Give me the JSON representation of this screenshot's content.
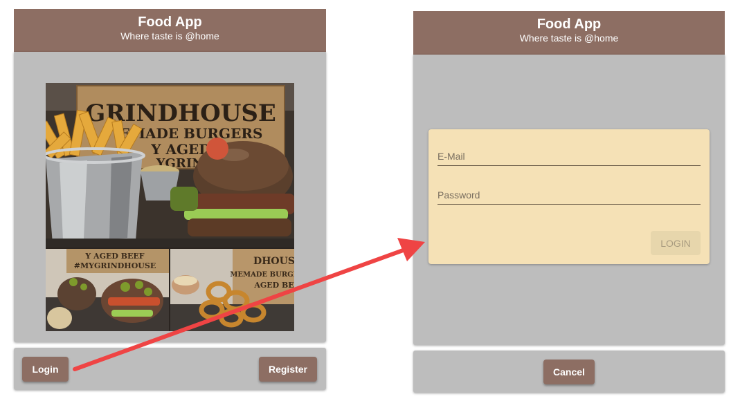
{
  "left_screen": {
    "header": {
      "title": "Food App",
      "subtitle": "Where taste is @home"
    },
    "collage": {
      "main_photo": {
        "sign_line1": "GRINDHOUSE",
        "sign_line2": "EMADE BURGERS",
        "sign_line3": "Y AGED BE",
        "sign_line4": "YGRINDH"
      },
      "bottom_left_photo": {
        "sign_text1": "Y AGED BEEF",
        "sign_text2": "#MYGRINDHOUSE"
      },
      "bottom_right_photo": {
        "sign_text1": "DHOUS",
        "sign_text2": "MEMADE BURGER",
        "sign_text3": "AGED BE"
      }
    },
    "footer": {
      "login_label": "Login",
      "register_label": "Register"
    }
  },
  "right_screen": {
    "header": {
      "title": "Food App",
      "subtitle": "Where taste is @home"
    },
    "form": {
      "email_placeholder": "E-Mail",
      "password_placeholder": "Password",
      "login_label": "LOGIN"
    },
    "footer": {
      "cancel_label": "Cancel"
    }
  },
  "colors": {
    "brand": "#8d6e63",
    "panel": "#bdbdbd",
    "card": "#f5e1b6",
    "arrow": "#ef4444"
  }
}
